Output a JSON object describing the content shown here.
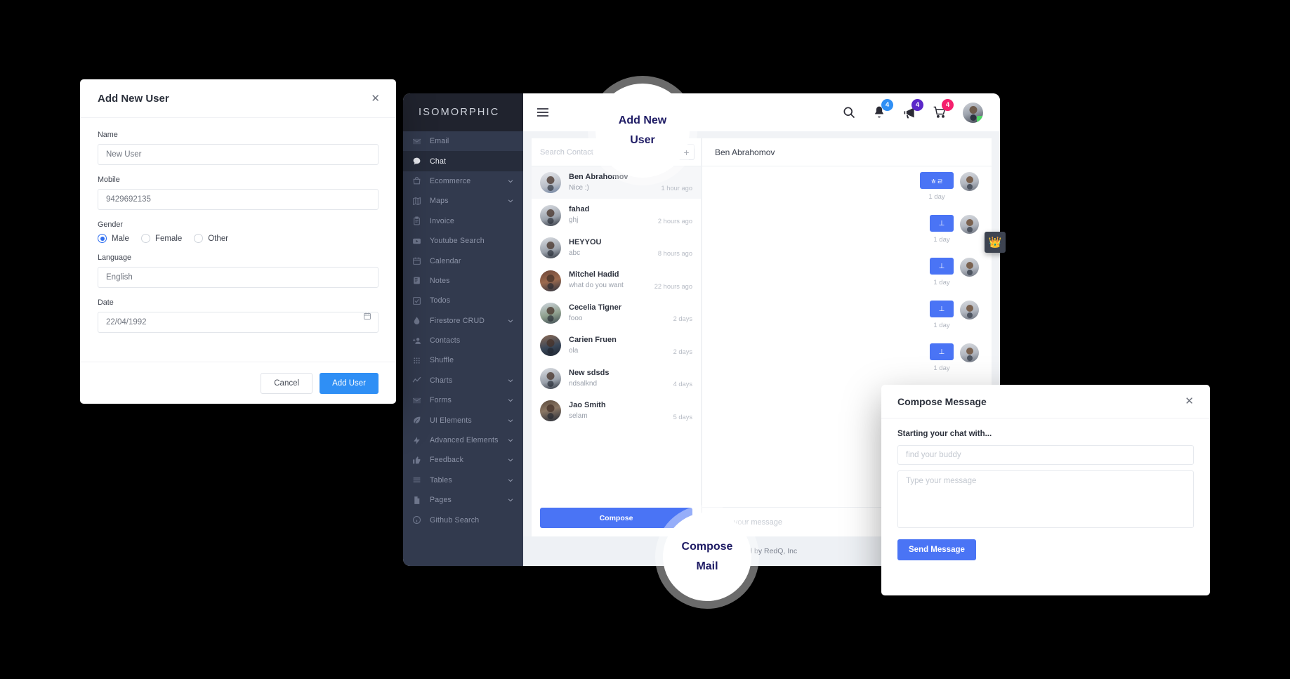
{
  "app": {
    "logo": "ISOMORPHIC",
    "footer": "Created by RedQ, Inc",
    "header": {
      "search_icon": "search-icon",
      "notifications": {
        "icon": "bell-icon",
        "count": "4",
        "color": "#2f8ff5"
      },
      "messages": {
        "icon": "megaphone-icon",
        "count": "4",
        "color": "#5b27c9"
      },
      "cart": {
        "icon": "cart-icon",
        "count": "4",
        "color": "#f5206d"
      },
      "profile": {
        "icon": "avatar",
        "status": "online"
      }
    }
  },
  "sidebar": {
    "items": [
      {
        "label": "Email",
        "icon": "envelope-icon",
        "expandable": false,
        "active": false
      },
      {
        "label": "Chat",
        "icon": "chat-bubble-icon",
        "expandable": false,
        "active": true
      },
      {
        "label": "Ecommerce",
        "icon": "bag-icon",
        "expandable": true,
        "active": false
      },
      {
        "label": "Maps",
        "icon": "map-icon",
        "expandable": true,
        "active": false
      },
      {
        "label": "Invoice",
        "icon": "clipboard-icon",
        "expandable": false,
        "active": false
      },
      {
        "label": "Youtube Search",
        "icon": "play-icon",
        "expandable": false,
        "active": false
      },
      {
        "label": "Calendar",
        "icon": "calendar-icon",
        "expandable": false,
        "active": false
      },
      {
        "label": "Notes",
        "icon": "notes-icon",
        "expandable": false,
        "active": false
      },
      {
        "label": "Todos",
        "icon": "checkbox-icon",
        "expandable": false,
        "active": false
      },
      {
        "label": "Firestore CRUD",
        "icon": "droplet-icon",
        "expandable": true,
        "active": false
      },
      {
        "label": "Contacts",
        "icon": "add-person-icon",
        "expandable": false,
        "active": false
      },
      {
        "label": "Shuffle",
        "icon": "grid-dots-icon",
        "expandable": false,
        "active": false
      },
      {
        "label": "Charts",
        "icon": "trend-line-icon",
        "expandable": true,
        "active": false
      },
      {
        "label": "Forms",
        "icon": "envelope-icon",
        "expandable": true,
        "active": false
      },
      {
        "label": "UI Elements",
        "icon": "leaf-icon",
        "expandable": true,
        "active": false
      },
      {
        "label": "Advanced Elements",
        "icon": "bolt-icon",
        "expandable": true,
        "active": false
      },
      {
        "label": "Feedback",
        "icon": "thumbs-up-icon",
        "expandable": true,
        "active": false
      },
      {
        "label": "Tables",
        "icon": "rows-icon",
        "expandable": true,
        "active": false
      },
      {
        "label": "Pages",
        "icon": "page-icon",
        "expandable": true,
        "active": false
      },
      {
        "label": "Github Search",
        "icon": "github-icon",
        "expandable": false,
        "active": false
      }
    ]
  },
  "chat": {
    "search_placeholder": "Search Contact",
    "search_value": "",
    "add_contact_label": "+",
    "compose_label": "Compose",
    "conversation_title": "Ben Abrahomov",
    "message_placeholder": "Type your message",
    "messages": [
      {
        "text": "ㅎㄹ",
        "time": "1 day"
      },
      {
        "text": "⊥",
        "time": "1 day"
      },
      {
        "text": "⊥",
        "time": "1 day"
      },
      {
        "text": "⊥",
        "time": "1 day"
      },
      {
        "text": "⊥",
        "time": "1 day"
      }
    ],
    "contacts": [
      {
        "name": "Ben Abrahomov",
        "message": "Nice :)",
        "time": "1 hour ago",
        "active": true
      },
      {
        "name": "fahad",
        "message": "ghj",
        "time": "2 hours ago",
        "active": false
      },
      {
        "name": "HEYYOU",
        "message": "abc",
        "time": "8 hours ago",
        "active": false
      },
      {
        "name": "Mitchel Hadid",
        "message": "what do you want",
        "time": "22 hours ago",
        "active": false
      },
      {
        "name": "Cecelia Tigner",
        "message": "fooo",
        "time": "2 days",
        "active": false
      },
      {
        "name": "Carien Fruen",
        "message": "ola",
        "time": "2 days",
        "active": false
      },
      {
        "name": "New sdsds",
        "message": "ndsalknd",
        "time": "4 days",
        "active": false
      },
      {
        "name": "Jao Smith",
        "message": "selam",
        "time": "5 days",
        "active": false
      }
    ]
  },
  "add_user_dialog": {
    "title": "Add New User",
    "close_label": "✕",
    "fields": {
      "name": {
        "label": "Name",
        "value": "New User"
      },
      "mobile": {
        "label": "Mobile",
        "value": "9429692135"
      },
      "gender": {
        "label": "Gender",
        "selected": "Male",
        "options": [
          "Male",
          "Female",
          "Other"
        ]
      },
      "language": {
        "label": "Language",
        "value": "English"
      },
      "date": {
        "label": "Date",
        "value": "22/04/1992"
      }
    },
    "cancel_label": "Cancel",
    "submit_label": "Add User"
  },
  "compose_dialog": {
    "title": "Compose Message",
    "close_label": "✕",
    "subtitle": "Starting your chat with...",
    "buddy_placeholder": "find your buddy",
    "buddy_value": "",
    "message_placeholder": "Type your message",
    "message_value": "",
    "send_label": "Send Message"
  },
  "callouts": {
    "add_user": {
      "line1": "Add New",
      "line2": "User"
    },
    "compose_mail": {
      "line1": "Compose",
      "line2": "Mail"
    }
  }
}
